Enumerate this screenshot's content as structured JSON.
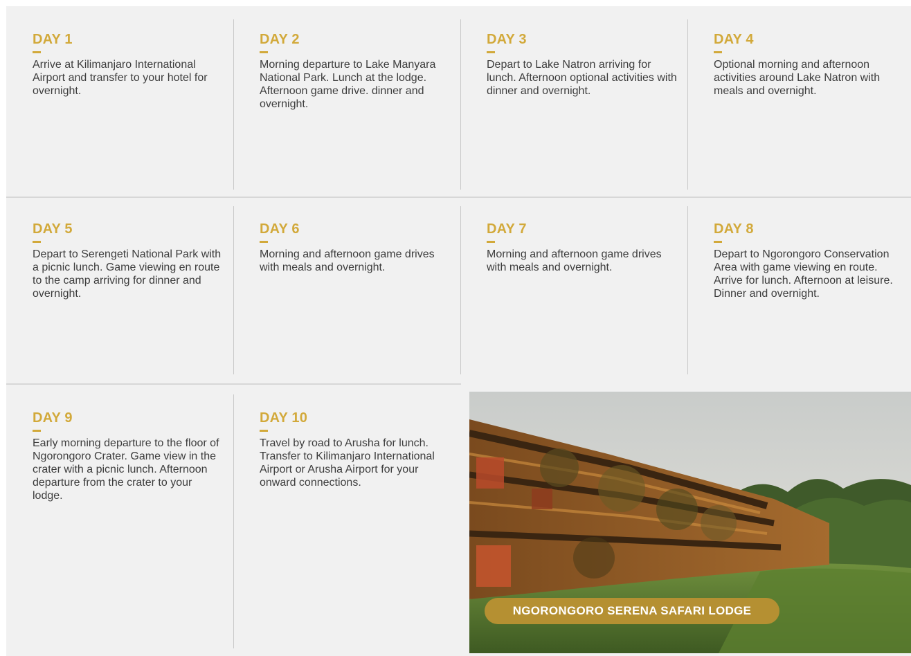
{
  "itinerary": {
    "days": [
      {
        "title": "DAY 1",
        "text": "Arrive at Kilimanjaro International Airport and transfer to your hotel for overnight."
      },
      {
        "title": "DAY 2",
        "text": "Morning departure to Lake Manyara National Park. Lunch at the lodge. Afternoon game drive. dinner and overnight."
      },
      {
        "title": "DAY 3",
        "text": "Depart to Lake Natron arriving for lunch. Afternoon optional activities with dinner and overnight."
      },
      {
        "title": "DAY 4",
        "text": "Optional morning and afternoon activities around Lake Natron with meals and overnight."
      },
      {
        "title": "DAY 5",
        "text": "Depart to Serengeti National Park with a picnic lunch. Game viewing en route to the camp arriving for dinner and overnight."
      },
      {
        "title": "DAY 6",
        "text": "Morning and afternoon game drives with meals and overnight."
      },
      {
        "title": "DAY 7",
        "text": "Morning and afternoon game drives with meals and overnight."
      },
      {
        "title": "DAY 8",
        "text": "Depart to Ngorongoro Conservation Area with game viewing en route. Arrive for lunch. Afternoon at leisure. Dinner and overnight."
      },
      {
        "title": "DAY 9",
        "text": "Early morning departure to the floor of Ngorongoro Crater. Game view in the crater with a picnic lunch.  Afternoon departure from the crater to your lodge."
      },
      {
        "title": "DAY 10",
        "text": "Travel by road to Arusha for lunch. Transfer to Kilimanjaro International Airport or Arusha Airport for your onward connections."
      }
    ]
  },
  "photo": {
    "caption": "NGORONGORO SERENA SAFARI LODGE"
  },
  "colors": {
    "accent": "#d2a93a",
    "caption_bg": "#b59032",
    "panel_bg": "#f1f1f1",
    "body_text": "#3d3d3d"
  }
}
